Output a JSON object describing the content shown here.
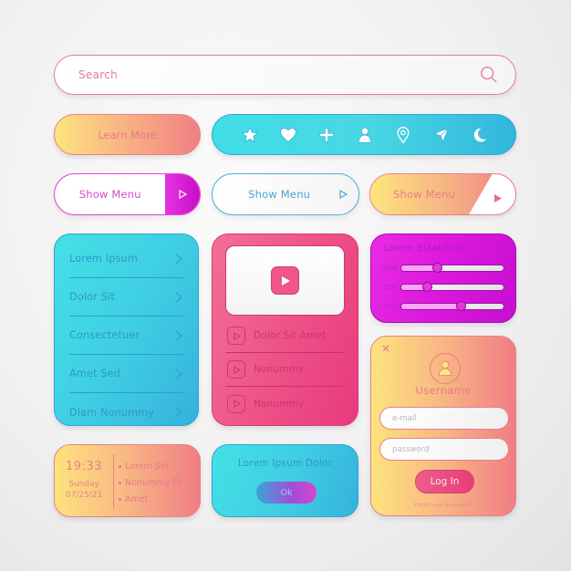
{
  "search": {
    "placeholder": "Search",
    "icon": "search-icon"
  },
  "learn_more": {
    "label": "Learn More"
  },
  "icon_bar": {
    "icons": [
      "star-icon",
      "heart-icon",
      "plus-icon",
      "user-icon",
      "location-pin-icon",
      "send-icon",
      "moon-icon"
    ]
  },
  "show_menu_buttons": [
    {
      "label": "Show Menu",
      "style": "magenta"
    },
    {
      "label": "Show Menu",
      "style": "blue"
    },
    {
      "label": "Show Menu",
      "style": "gradient"
    }
  ],
  "menu_list": {
    "items": [
      {
        "label": "Lorem Ipsum"
      },
      {
        "label": "Dolor Sit"
      },
      {
        "label": "Consectetuer"
      },
      {
        "label": "Amet Sed"
      },
      {
        "label": "Diam Nonummy"
      }
    ]
  },
  "video_card": {
    "tracks": [
      {
        "label": "Dolor Sit Amet"
      },
      {
        "label": "Nonummy"
      },
      {
        "label": "Nonummy"
      }
    ]
  },
  "statistics": {
    "title": "Lorem Estatistics",
    "rows": [
      {
        "label": "30%",
        "value": 0.35
      },
      {
        "label": "25%",
        "value": 0.25
      },
      {
        "label": "60%",
        "value": 0.58
      }
    ]
  },
  "login": {
    "title": "Username",
    "email_placeholder": "e-mail",
    "password_placeholder": "password",
    "login_label": "Log In",
    "forgot_label": "Forgot your password?"
  },
  "clock": {
    "time": "19:33",
    "day": "Sunday",
    "date": "07/25/21",
    "items": [
      "Lorem Set",
      "Nonummy Et",
      "Amet"
    ]
  },
  "dialog": {
    "message": "Lorem Ipsum Dolor",
    "ok_label": "Ok"
  },
  "colors": {
    "pink": "#ea7a88",
    "cyan": "#40dde6",
    "magenta": "#db18dc",
    "yellow": "#fde57e"
  }
}
